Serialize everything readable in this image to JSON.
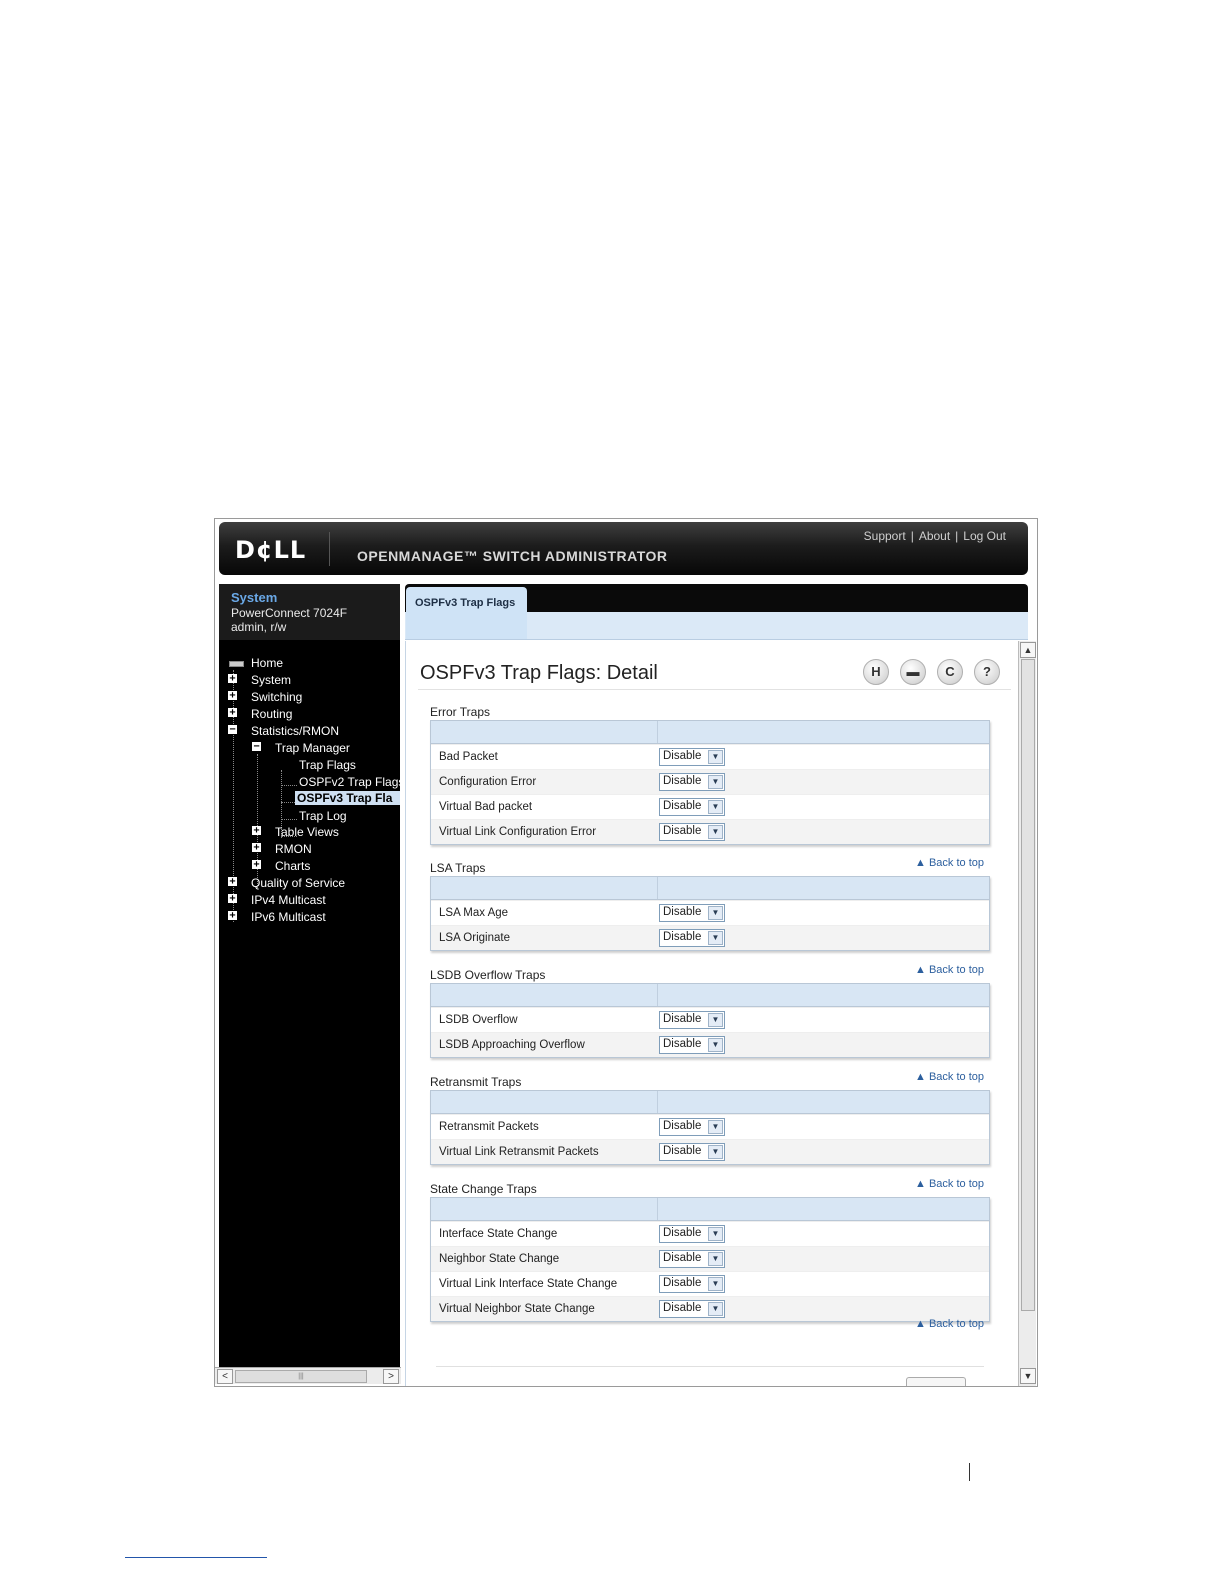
{
  "header": {
    "logo": "D¢LL",
    "app_title": "OPENMANAGE™ SWITCH ADMINISTRATOR",
    "links": [
      "Support",
      "About",
      "Log Out"
    ]
  },
  "system": {
    "title": "System",
    "device": "PowerConnect 7024F",
    "user": "admin, r/w"
  },
  "nav": {
    "home": "Home",
    "system": "System",
    "switching": "Switching",
    "routing": "Routing",
    "stats": "Statistics/RMON",
    "trap_manager": "Trap Manager",
    "trap_flags": "Trap Flags",
    "ospfv2": "OSPFv2 Trap Flags",
    "ospfv3": "OSPFv3 Trap Fla",
    "trap_log": "Trap Log",
    "table_views": "Table Views",
    "rmon": "RMON",
    "charts": "Charts",
    "qos": "Quality of Service",
    "ipv4mc": "IPv4 Multicast",
    "ipv6mc": "IPv6 Multicast"
  },
  "tab": {
    "label": "OSPFv3 Trap Flags"
  },
  "page": {
    "title": "OSPFv3 Trap Flags: Detail",
    "back_to_top": "Back to top",
    "icons": [
      "save-icon",
      "print-icon",
      "refresh-icon",
      "help-icon"
    ]
  },
  "sections": [
    {
      "title": "Error Traps",
      "rows": [
        {
          "label": "Bad Packet",
          "value": "Disable"
        },
        {
          "label": "Configuration Error",
          "value": "Disable"
        },
        {
          "label": "Virtual Bad packet",
          "value": "Disable"
        },
        {
          "label": "Virtual Link Configuration Error",
          "value": "Disable"
        }
      ]
    },
    {
      "title": "LSA Traps",
      "rows": [
        {
          "label": "LSA Max Age",
          "value": "Disable"
        },
        {
          "label": "LSA Originate",
          "value": "Disable"
        }
      ]
    },
    {
      "title": "LSDB Overflow Traps",
      "rows": [
        {
          "label": "LSDB Overflow",
          "value": "Disable"
        },
        {
          "label": "LSDB Approaching Overflow",
          "value": "Disable"
        }
      ]
    },
    {
      "title": "Retransmit Traps",
      "rows": [
        {
          "label": "Retransmit Packets",
          "value": "Disable"
        },
        {
          "label": "Virtual Link Retransmit Packets",
          "value": "Disable"
        }
      ]
    },
    {
      "title": "State Change Traps",
      "rows": [
        {
          "label": "Interface State Change",
          "value": "Disable"
        },
        {
          "label": "Neighbor State Change",
          "value": "Disable"
        },
        {
          "label": "Virtual Link Interface State Change",
          "value": "Disable"
        },
        {
          "label": "Virtual Neighbor State Change",
          "value": "Disable"
        }
      ]
    }
  ],
  "colors": {
    "header_bg": "#111111",
    "tab_bg": "#cfe3f6",
    "link": "#2c5f9e",
    "sidebar_bg": "#000000",
    "system_title": "#6aa8e6"
  }
}
